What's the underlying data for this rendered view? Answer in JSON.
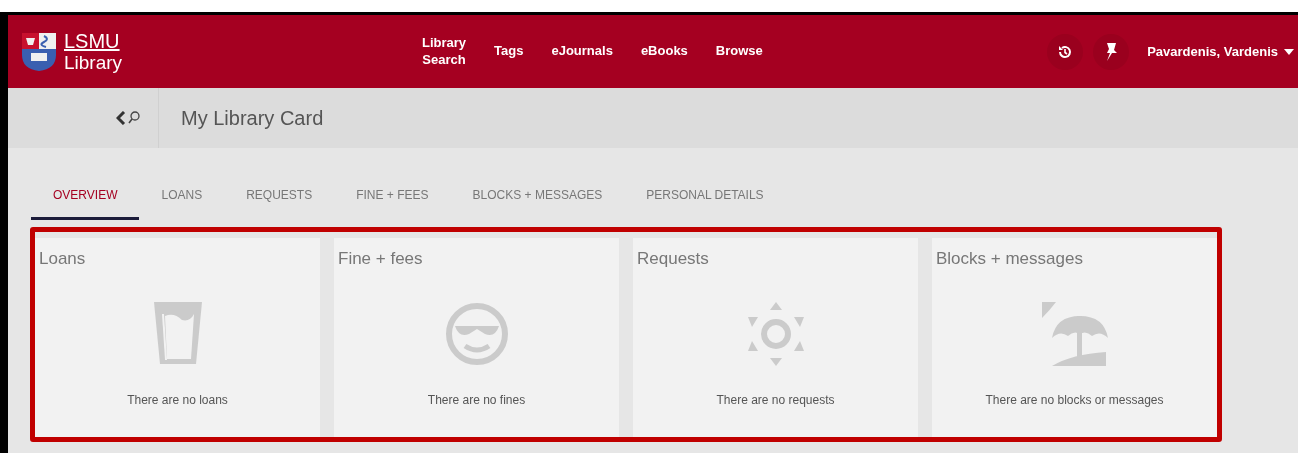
{
  "logo": {
    "line1": "LSMU",
    "line2": "Library"
  },
  "nav": [
    {
      "label": "Library Search"
    },
    {
      "label": "Tags"
    },
    {
      "label": "eJournals"
    },
    {
      "label": "eBooks"
    },
    {
      "label": "Browse"
    }
  ],
  "user": {
    "name": "Pavardenis, Vardenis"
  },
  "page_title": "My Library Card",
  "tabs": [
    {
      "label": "OVERVIEW",
      "selected": true
    },
    {
      "label": "LOANS",
      "selected": false
    },
    {
      "label": "REQUESTS",
      "selected": false
    },
    {
      "label": "FINE + FEES",
      "selected": false
    },
    {
      "label": "BLOCKS + MESSAGES",
      "selected": false
    },
    {
      "label": "PERSONAL DETAILS",
      "selected": false
    }
  ],
  "cards": [
    {
      "kind": "glass",
      "title": "Loans",
      "message": "There are no loans"
    },
    {
      "kind": "smiley",
      "title": "Fine + fees",
      "message": "There are no fines"
    },
    {
      "kind": "sun",
      "title": "Requests",
      "message": "There are no requests"
    },
    {
      "kind": "beach",
      "title": "Blocks + messages",
      "message": "There are no blocks or messages"
    }
  ]
}
